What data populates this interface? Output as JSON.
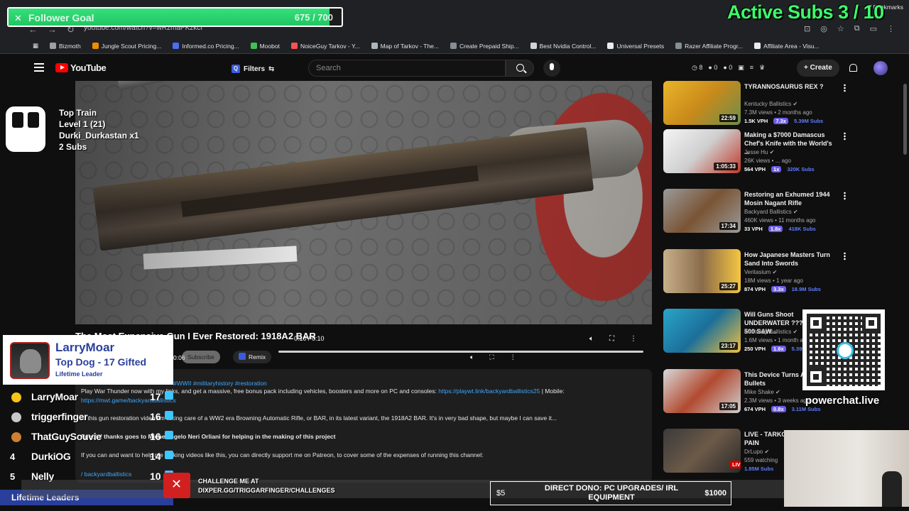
{
  "browser": {
    "url": "youtube.com/watch?v=wRzmaPKzkcI",
    "bookmarks": [
      {
        "label": "Bizmoth",
        "color": "#9aa0a6"
      },
      {
        "label": "Jungle Scout Pricing...",
        "color": "#f08c00"
      },
      {
        "label": "Informed.co Pricing...",
        "color": "#4c6ef5"
      },
      {
        "label": "Moobot",
        "color": "#40c057"
      },
      {
        "label": "NoiceGuy Tarkov - Y...",
        "color": "#fa5252"
      },
      {
        "label": "Map of Tarkov - The...",
        "color": "#adb5bd"
      },
      {
        "label": "Create Prepaid Ship...",
        "color": "#868e96"
      },
      {
        "label": "Best Nvidia Control...",
        "color": "#ced4da"
      },
      {
        "label": "Universal Presets",
        "color": "#e9ecef"
      },
      {
        "label": "Razer Affiliate Progr...",
        "color": "#868e96"
      },
      {
        "label": "Affiliate Area - Visu...",
        "color": "#e9ecef"
      }
    ],
    "all_bookmarks": "All Bookmarks"
  },
  "youtube": {
    "logo": "YouTube",
    "filters": "Filters",
    "search_placeholder": "Search",
    "header_stats": [
      "8",
      "0",
      "0"
    ],
    "create": "Create"
  },
  "video": {
    "title": "The Most Expensive Gun I Ever Restored: 1918A2 BAR",
    "time": "0:10 / 0:10",
    "mini_time": "0:06",
    "subscribe": "Subscribe",
    "remix": "Remix",
    "tags": "#WWII #militaryhistory #restoration",
    "description": [
      {
        "text": "Play War Thunder now with my links, and get a massive, free bonus pack including vehicles, boosters and more on PC and consoles: ",
        "link": "https://playwt.link/backyardballistics25",
        "after": " | Mobile:"
      },
      {
        "text": "",
        "link": "https://mwt.game/backyardballistics",
        "after": ""
      },
      {
        "text": "In this gun restoration video I'm taking care of a WW2 era Browning Automatic Rifle, or BAR, in its latest variant, the 1918A2 BAR. It's in very bad shape, but maybe I can save it...",
        "link": "",
        "after": ""
      },
      {
        "text": "Special thanks goes to Michelangelo Neri Orliani for helping in the making of this project",
        "link": "",
        "after": "",
        "bold": true
      },
      {
        "text": "If you can and want to help me making videos like this, you can directly support me on Patreon, to cover some of the expenses of running this channel:",
        "link": "",
        "after": ""
      },
      {
        "text": "",
        "link": "/ backyardballistics",
        "after": ""
      }
    ]
  },
  "recommendations": [
    {
      "title": "TYRANNOSAURUS REX ?",
      "channel": "Kentucky Ballistics",
      "meta": "7.3M views • 2 months ago",
      "duration": "22:59",
      "vph": "1.5K VPH",
      "mult": "7.3x",
      "subs": "5.39M Subs",
      "thumb": "linear-gradient(135deg,#e9b52a,#c98a1a 50%,#6b8e4e)"
    },
    {
      "title": "Making a $7000 Damascus Chef's Knife with the World's ...",
      "channel": "Jesse Hu",
      "meta": "26K views • ... ago",
      "duration": "1:05:33",
      "vph": "564 VPH",
      "mult": "1x",
      "subs": "320K Subs",
      "thumb": "linear-gradient(135deg,#f4f4f4,#cfcfcf 50%,#c0392b)"
    },
    {
      "title": "Restoring an Exhumed 1944 Mosin Nagant Rifle",
      "channel": "Backyard Ballistics",
      "meta": "460K views • 11 months ago",
      "duration": "17:34",
      "vph": "33 VPH",
      "mult": "1.8x",
      "subs": "418K Subs",
      "thumb": "linear-gradient(135deg,#9a9a9a,#7a5434 50%,#9a9a9a)"
    },
    {
      "title": "How Japanese Masters Turn Sand Into Swords",
      "channel": "Veritasium",
      "meta": "18M views • 1 year ago",
      "duration": "25:27",
      "vph": "874 VPH",
      "mult": "3.3x",
      "subs": "18.9M Subs",
      "thumb": "linear-gradient(90deg,#c7b08a,#8a6b4a 50%,#f5c542)"
    },
    {
      "title": "Will Guns Shoot UNDERWATER ??? (50 BMG, 500 S&W...",
      "channel": "Kentucky Ballistics",
      "meta": "1.6M views • 1 month ago",
      "duration": "23:17",
      "vph": "250 VPH",
      "mult": "1.8x",
      "subs": "5.39M Subs",
      "thumb": "linear-gradient(135deg,#2aa5c8,#1b6f9a 50%,#f0c040)"
    },
    {
      "title": "This Device Turns Air Into Bullets",
      "channel": "Mike Shake",
      "meta": "2.3M views • 3 weeks ago",
      "duration": "17:05",
      "vph": "674 VPH",
      "mult": "0.8x",
      "subs": "3.11M Subs",
      "thumb": "linear-gradient(135deg,#d9d9d9,#b14a30 50%,#cfcfcf)"
    },
    {
      "title": "LIVE - TARKOV DEALER OF PAIN",
      "channel": "DrLupo",
      "meta": "559 watching",
      "duration": "",
      "vph": "",
      "mult": "",
      "subs": "1.85M Subs",
      "live": "LIVE",
      "thumb": "linear-gradient(135deg,#3a3a3a,#6c5a48 50%,#2a2a2a)"
    }
  ],
  "overlay": {
    "follower_goal": {
      "label": "Follower Goal",
      "count": "675 / 700",
      "current": 675,
      "target": 700
    },
    "active_subs": "Active Subs  3 / 10",
    "top_train": [
      "Top Train",
      "Level 1  (21)",
      "Durki_Durkastan x1",
      "2 Subs"
    ],
    "leader": {
      "name": "LarryMoar",
      "title": "Top Dog - 17 Gifted",
      "tag": "Lifetime Leader"
    },
    "leaderboard": [
      {
        "rank": "",
        "medal": "#f5c518",
        "name": "LarryMoar",
        "count": "17"
      },
      {
        "rank": "",
        "medal": "#c8c8c8",
        "name": "triggerfinger",
        "count": "16"
      },
      {
        "rank": "",
        "medal": "#cd7f32",
        "name": "ThatGuySouvie",
        "count": "16"
      },
      {
        "rank": "4",
        "medal": "",
        "name": "DurkiOG",
        "count": "14"
      },
      {
        "rank": "5",
        "medal": "",
        "name": "Nelly",
        "count": "10"
      }
    ],
    "leaderboard_footer": "Lifetime Leaders",
    "challenge": [
      "CHALLENGE ME AT",
      "DIXPER.GG/TRIGGARFINGER/CHALLENGES"
    ],
    "dono": {
      "min": "$5",
      "title": "DIRECT DONO: PC UPGRADES/ IRL EQUIPMENT",
      "max": "$1000"
    },
    "powerchat": "powerchat.live"
  }
}
